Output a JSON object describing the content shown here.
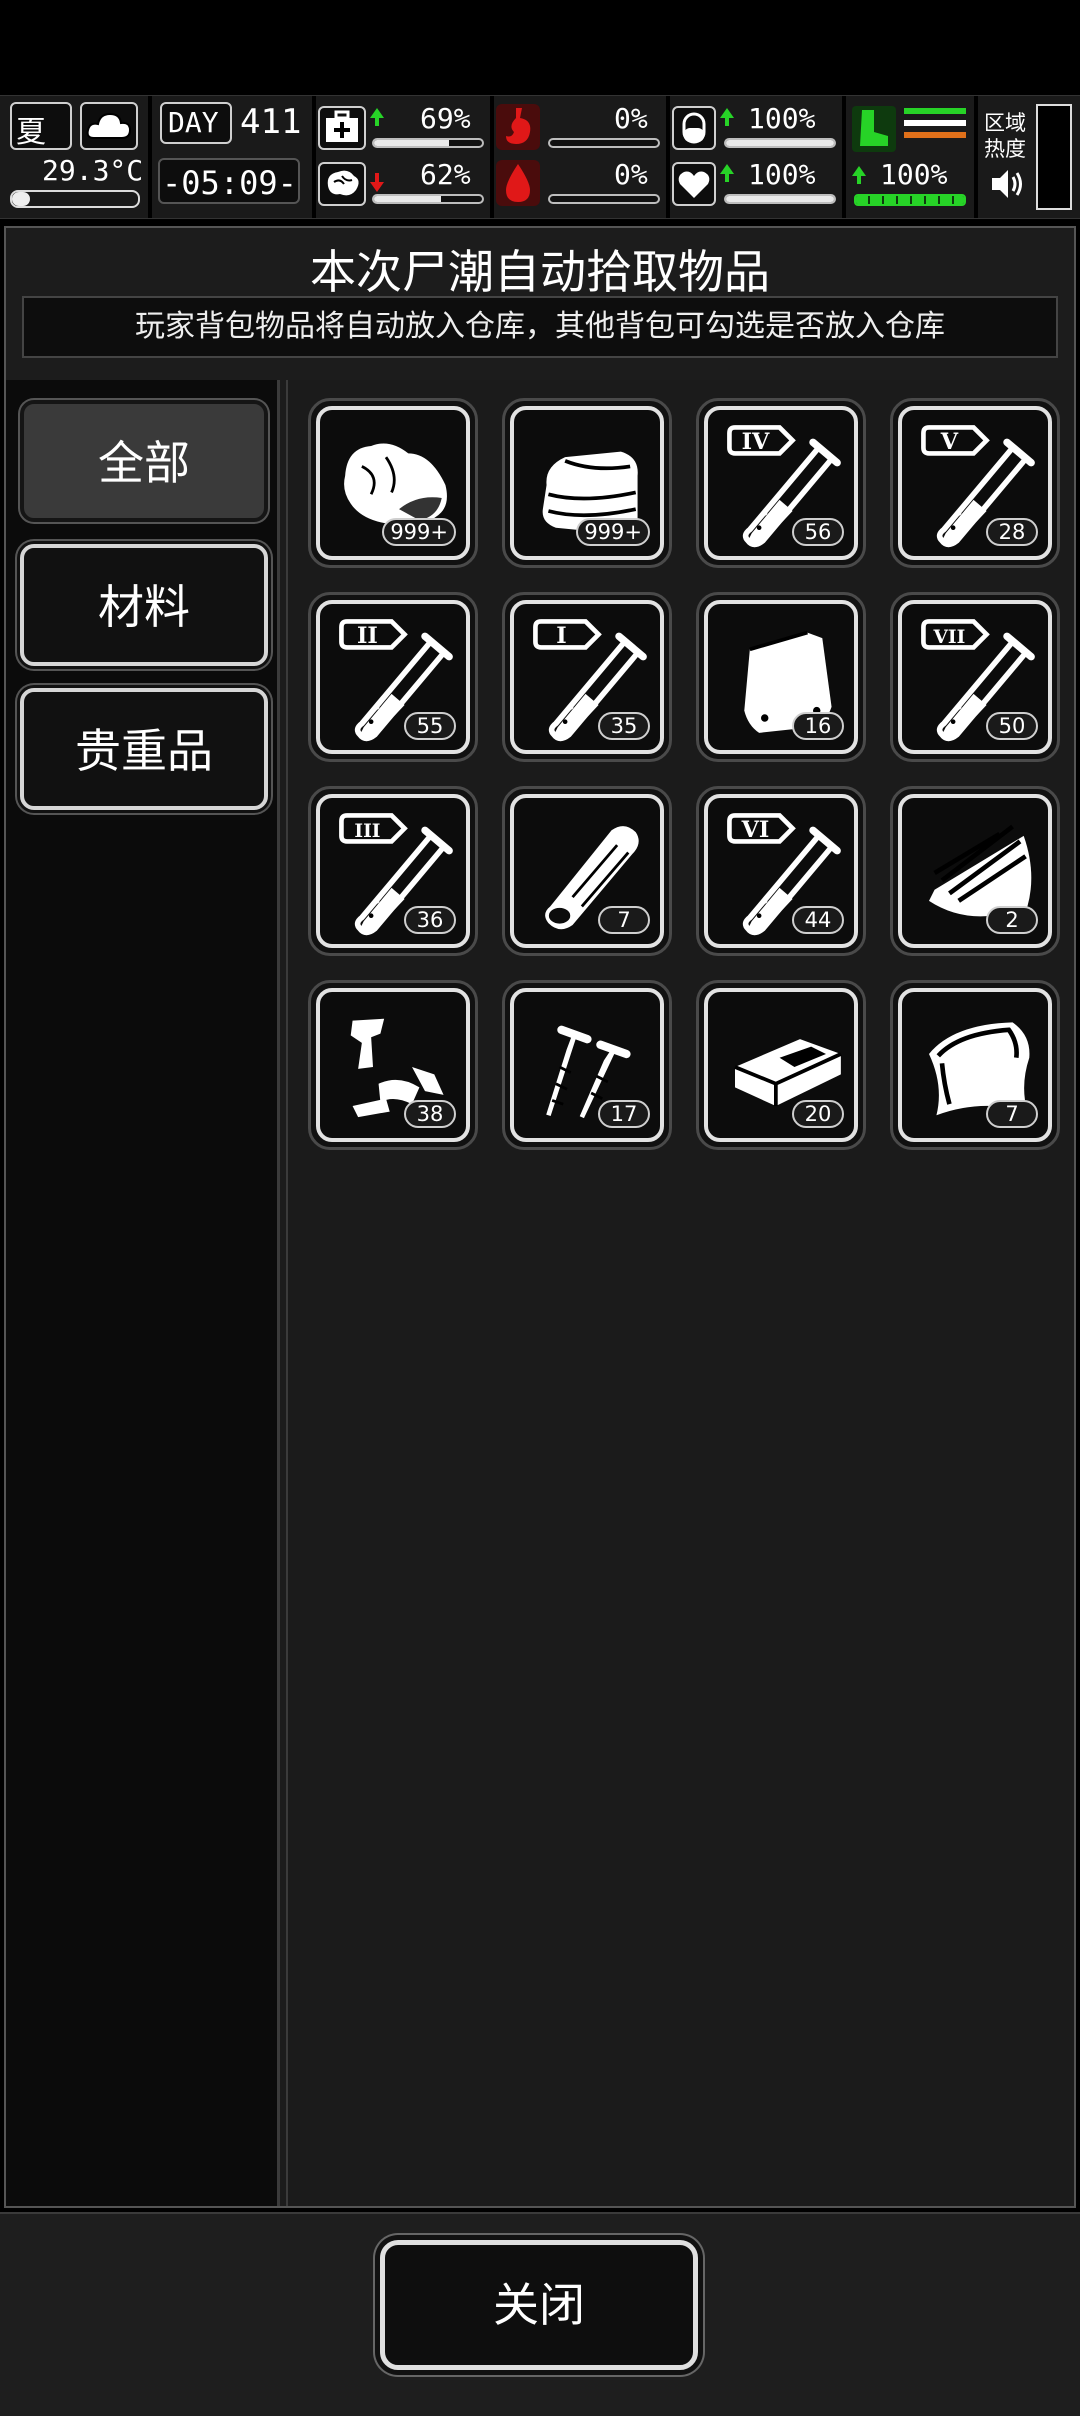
{
  "hud": {
    "season": "夏",
    "temperature": "29.3°C",
    "day_label": "DAY",
    "day_number": "411",
    "clock": "-05:09-",
    "stats": {
      "health": "69%",
      "mental": "62%",
      "hunger": "0%",
      "thirst": "0%",
      "defense": "100%",
      "heart": "100%",
      "stamina": "100%"
    },
    "stat_levels": {
      "health": 0.69,
      "mental": 0.62,
      "hunger": 0.0,
      "thirst": 0.0,
      "defense": 1.0,
      "heart": 1.0,
      "stamina": 1.0
    },
    "region_heat_label": "区域热度",
    "colors": {
      "up": "#27d327",
      "down": "#e01818",
      "stomach": "#e01818",
      "stamina": "#27d327",
      "bar_orange": "#e0701a"
    }
  },
  "dialog": {
    "title": "本次尸潮自动拾取物品",
    "subtitle": "玩家背包物品将自动放入仓库，其他背包可勾选是否放入仓库"
  },
  "tabs": [
    {
      "label": "全部",
      "active": true
    },
    {
      "label": "材料",
      "active": false
    },
    {
      "label": "贵重品",
      "active": false
    }
  ],
  "items": [
    {
      "icon": "raw-meat-icon",
      "count": "999+"
    },
    {
      "icon": "cloth-icon",
      "count": "999+"
    },
    {
      "icon": "test-tube-iv-icon",
      "roman": "IV",
      "count": "56"
    },
    {
      "icon": "test-tube-v-icon",
      "roman": "V",
      "count": "28"
    },
    {
      "icon": "test-tube-ii-icon",
      "roman": "II",
      "count": "55"
    },
    {
      "icon": "test-tube-i-icon",
      "roman": "I",
      "count": "35"
    },
    {
      "icon": "bag-icon",
      "count": "16"
    },
    {
      "icon": "test-tube-vii-icon",
      "roman": "VII",
      "count": "50"
    },
    {
      "icon": "test-tube-iii-icon",
      "roman": "III",
      "count": "36"
    },
    {
      "icon": "wood-log-icon",
      "count": "7"
    },
    {
      "icon": "test-tube-vi-icon",
      "roman": "VI",
      "count": "44"
    },
    {
      "icon": "scrap-metal-icon",
      "count": "2"
    },
    {
      "icon": "scrap-parts-icon",
      "count": "38"
    },
    {
      "icon": "nails-icon",
      "count": "17"
    },
    {
      "icon": "brick-icon",
      "count": "20"
    },
    {
      "icon": "glass-sheet-icon",
      "count": "7"
    }
  ],
  "footer": {
    "close_label": "关闭"
  }
}
